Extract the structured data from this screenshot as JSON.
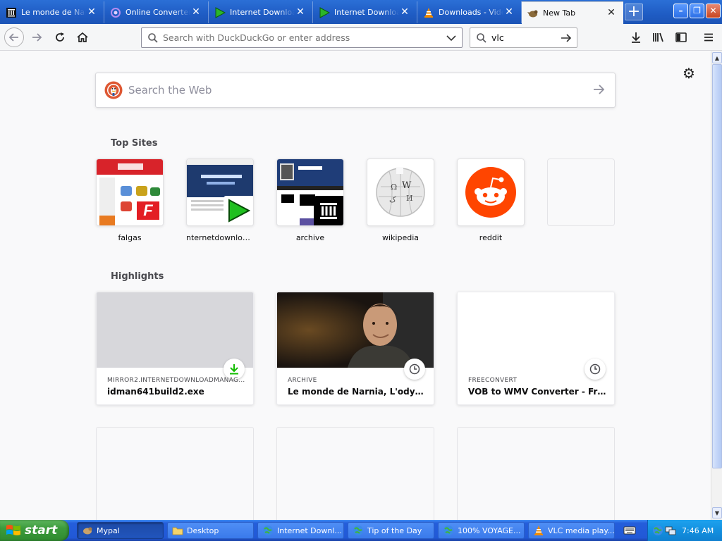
{
  "tabs": [
    {
      "label": "Le monde de Narnia",
      "icon": "archive-icon"
    },
    {
      "label": "Online Converter",
      "icon": "converter-icon"
    },
    {
      "label": "Internet Download Manager",
      "icon": "idm-icon"
    },
    {
      "label": "Internet Download Manager",
      "icon": "idm-icon"
    },
    {
      "label": "Downloads - VideoLAN",
      "icon": "vlc-icon"
    },
    {
      "label": "New Tab",
      "icon": "mypal-icon"
    }
  ],
  "navbar": {
    "url_placeholder": "Search with DuckDuckGo or enter address",
    "search_value": "vlc"
  },
  "content": {
    "websearch_placeholder": "Search the Web",
    "top_sites_title": "Top Sites",
    "highlights_title": "Highlights",
    "top_sites": [
      {
        "label": "falgas"
      },
      {
        "label": "nternetdownload..."
      },
      {
        "label": "archive"
      },
      {
        "label": "wikipedia"
      },
      {
        "label": "reddit"
      },
      {
        "label": ""
      }
    ],
    "highlights": [
      {
        "host": "MIRROR2.INTERNETDOWNLOADMANAGE...",
        "title": "idman641build2.exe",
        "type_icon": "download-icon"
      },
      {
        "host": "ARCHIVE",
        "title": "Le monde de Narnia, L'odyssée d...",
        "type_icon": "clock-icon"
      },
      {
        "host": "FREECONVERT",
        "title": "VOB to WMV Converter - FreeC...",
        "type_icon": "clock-icon"
      }
    ]
  },
  "taskbar": {
    "start_label": "start",
    "tasks": [
      {
        "label": "Mypal"
      },
      {
        "label": "Desktop"
      },
      {
        "label": "Internet Downl..."
      },
      {
        "label": "Tip of the Day"
      },
      {
        "label": "100% VOYAGE..."
      },
      {
        "label": "VLC media play..."
      }
    ],
    "clock": "7:46 AM"
  },
  "colors": {
    "tabbar": "#1f5cc4",
    "reddit": "#ff4500",
    "idm_green": "#2bb52b",
    "falgas_red": "#e31e24",
    "xp_start_green": "#3c9b3c"
  }
}
